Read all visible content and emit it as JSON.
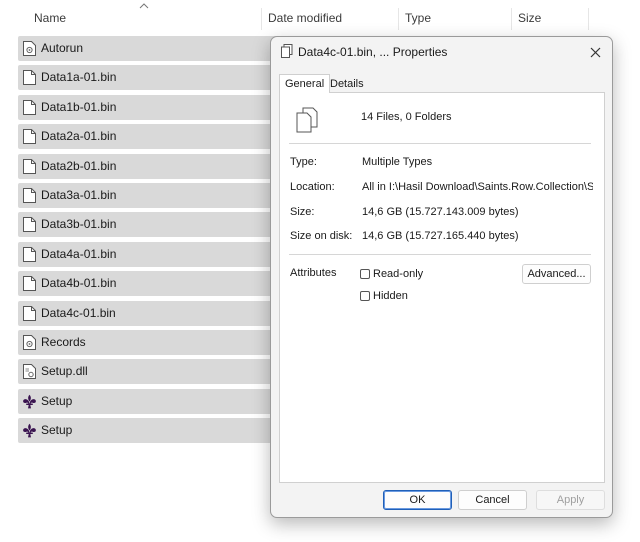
{
  "columns": {
    "name": "Name",
    "date_modified": "Date modified",
    "type": "Type",
    "size": "Size"
  },
  "files": [
    {
      "name": "Autorun",
      "icon": "settings-file-icon"
    },
    {
      "name": "Data1a-01.bin",
      "icon": "file-icon"
    },
    {
      "name": "Data1b-01.bin",
      "icon": "file-icon"
    },
    {
      "name": "Data2a-01.bin",
      "icon": "file-icon"
    },
    {
      "name": "Data2b-01.bin",
      "icon": "file-icon"
    },
    {
      "name": "Data3a-01.bin",
      "icon": "file-icon"
    },
    {
      "name": "Data3b-01.bin",
      "icon": "file-icon"
    },
    {
      "name": "Data4a-01.bin",
      "icon": "file-icon"
    },
    {
      "name": "Data4b-01.bin",
      "icon": "file-icon"
    },
    {
      "name": "Data4c-01.bin",
      "icon": "file-icon"
    },
    {
      "name": "Records",
      "icon": "settings-file-icon"
    },
    {
      "name": "Setup.dll",
      "icon": "dll-file-icon"
    },
    {
      "name": "Setup",
      "icon": "fleur-de-lis-icon"
    },
    {
      "name": "Setup",
      "icon": "fleur-de-lis-icon"
    }
  ],
  "dialog": {
    "title": "Data4c-01.bin, ... Properties",
    "tabs": [
      "General",
      "Details"
    ],
    "active_tab": "General",
    "summary": "14 Files, 0 Folders",
    "props": {
      "type_label": "Type:",
      "type_value": "Multiple Types",
      "location_label": "Location:",
      "location_value": "All in I:\\Hasil Download\\Saints.Row.Collection\\Saints",
      "size_label": "Size:",
      "size_value": "14,6 GB (15.727.143.009 bytes)",
      "size_on_disk_label": "Size on disk:",
      "size_on_disk_value": "14,6 GB (15.727.165.440 bytes)"
    },
    "attributes_label": "Attributes",
    "readonly_label": "Read-only",
    "hidden_label": "Hidden",
    "advanced_label": "Advanced...",
    "ok_label": "OK",
    "cancel_label": "Cancel",
    "apply_label": "Apply"
  },
  "colors": {
    "row_selected": "#d9d9d9",
    "dialog_bg": "#f3f3f3",
    "primary_border": "#1f5fb8",
    "fleur_purple": "#3a1450"
  }
}
